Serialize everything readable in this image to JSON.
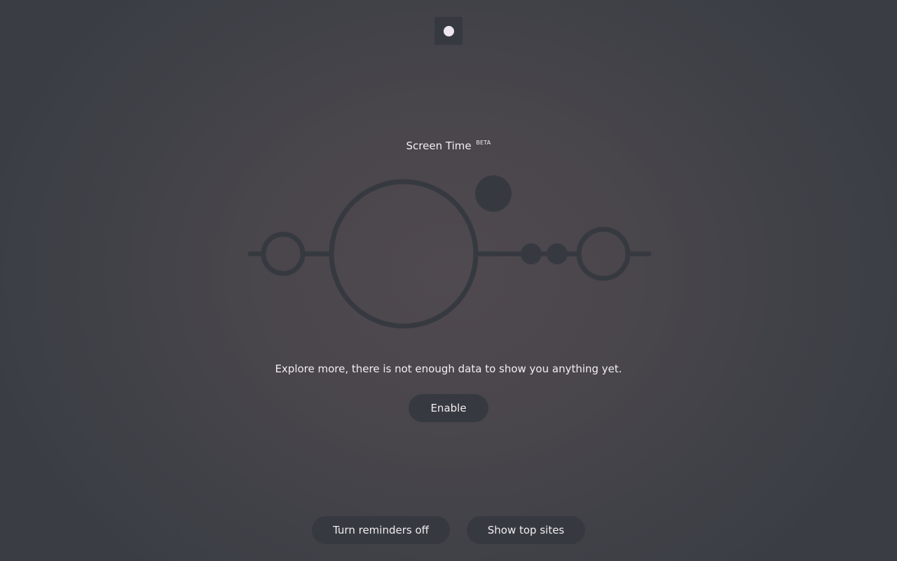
{
  "header": {
    "toggle_icon": "dot-toggle-icon"
  },
  "screen_time": {
    "title": "Screen Time",
    "badge": "BETA",
    "message": "Explore more, there is not enough data to show you anything yet.",
    "enable_label": "Enable"
  },
  "footer": {
    "reminders_label": "Turn reminders off",
    "top_sites_label": "Show top sites"
  },
  "colors": {
    "surface": "#363a40",
    "text": "#f1eef0",
    "accent_dot": "#ece6ef"
  }
}
